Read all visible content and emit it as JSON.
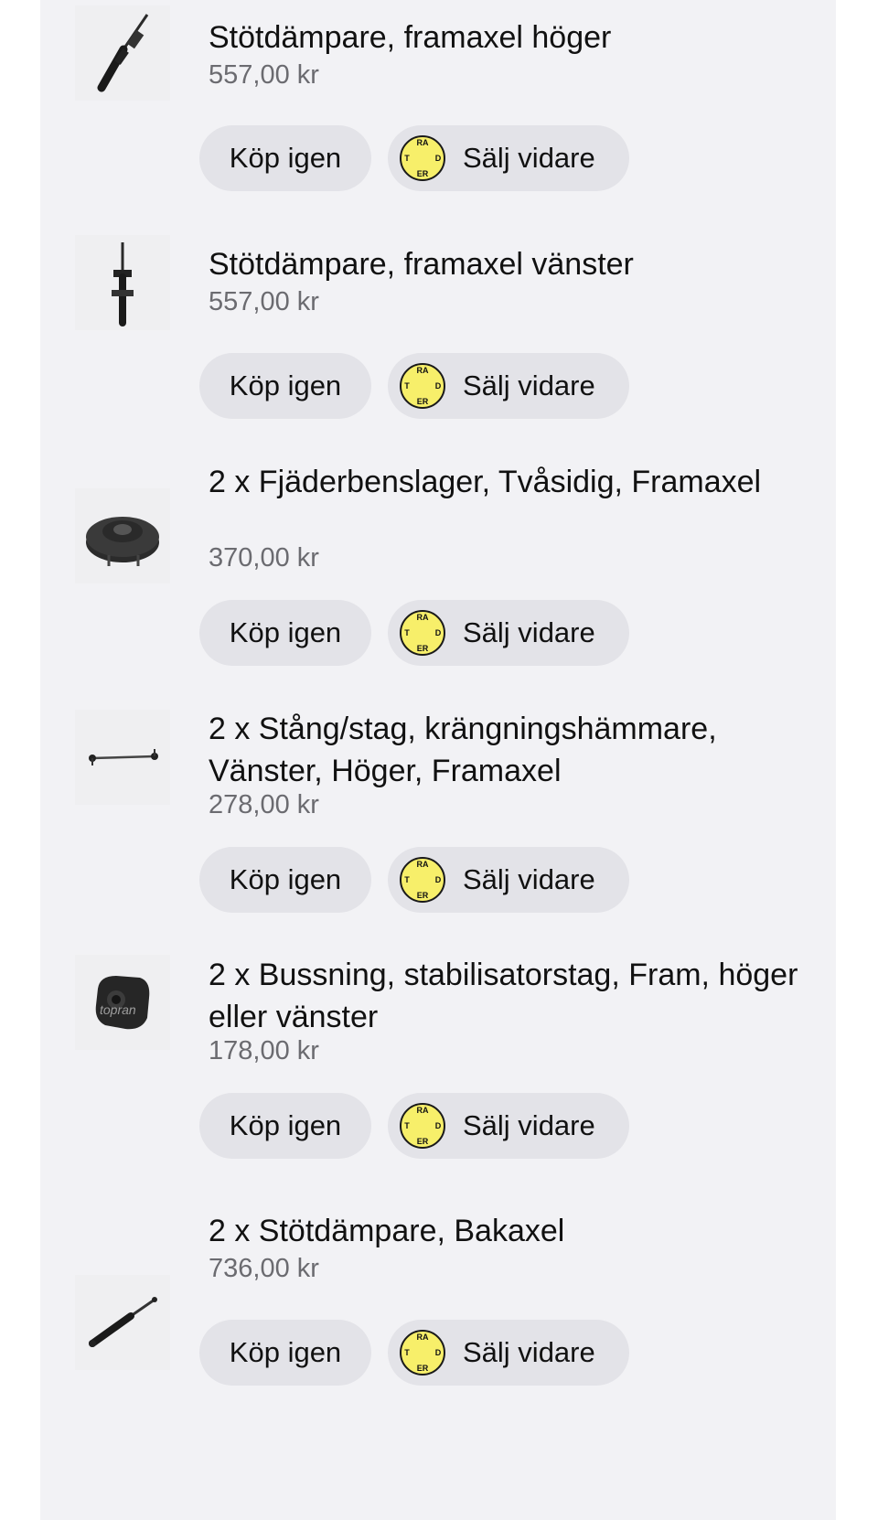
{
  "buttons": {
    "buy_again": "Köp igen",
    "resell": "Sälj vidare"
  },
  "tradera_logo_letters": [
    "T",
    "R",
    "A",
    "D",
    "E",
    "R",
    "A"
  ],
  "items": [
    {
      "title": "Stötdämpare, framaxel höger",
      "price": "557,00 kr",
      "image": "front-shock-absorber-right"
    },
    {
      "title": "Stötdämpare, framaxel vänster",
      "price": "557,00 kr",
      "image": "front-shock-absorber-left"
    },
    {
      "title": "2 x Fjäderbenslager, Tvåsidig, Framaxel",
      "price": "370,00 kr",
      "image": "strut-mount-bearing"
    },
    {
      "title": "2 x Stång/stag, krängningshämmare, Vänster, Höger, Framaxel",
      "price": "278,00 kr",
      "image": "stabilizer-link-rod"
    },
    {
      "title": "2 x Bussning, stabilisatorstag, Fram, höger eller vänster",
      "price": "178,00 kr",
      "image": "stabilizer-bushing"
    },
    {
      "title": "2 x Stötdämpare, Bakaxel",
      "price": "736,00 kr",
      "image": "rear-shock-absorber"
    }
  ],
  "colors": {
    "panel_bg": "#f2f2f5",
    "button_bg": "#e3e3e8",
    "tradera_yellow": "#f7ef6a",
    "price_gray": "#6b6b70"
  }
}
